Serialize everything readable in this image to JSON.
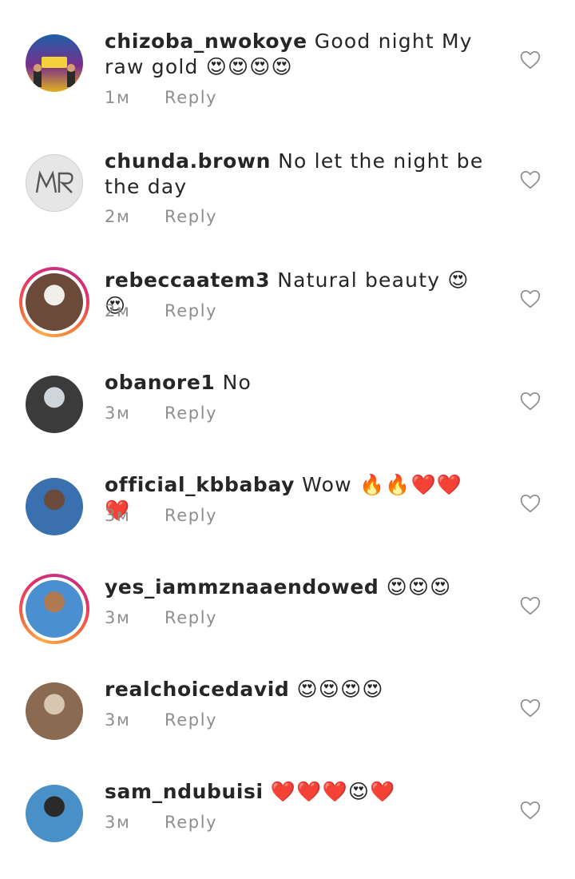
{
  "comments": [
    {
      "username": "chizoba_nwokoye",
      "text": "Good night My raw gold",
      "emoji": "😍😍😍😍",
      "time": "1м",
      "reply_label": "Reply",
      "avatar_icon": "movie-poster-avatar",
      "avatar_colors": [
        "#1f5fa8",
        "#e0b020"
      ],
      "story_ring": false
    },
    {
      "username": "chunda.brown",
      "text": "No let the night be the day",
      "emoji": "",
      "time": "2м",
      "reply_label": "Reply",
      "avatar_icon": "monogram-logo-avatar",
      "avatar_colors": [
        "#e6e6e6",
        "#555555"
      ],
      "story_ring": false
    },
    {
      "username": "rebeccaatem3",
      "text": "Natural beauty",
      "emoji": "😍😍",
      "time": "2м",
      "reply_label": "Reply",
      "avatar_icon": "person-photo-avatar",
      "avatar_colors": [
        "#6b4a3a",
        "#f1efe9"
      ],
      "story_ring": true
    },
    {
      "username": "obanore1",
      "text": "No",
      "emoji": "",
      "time": "3м",
      "reply_label": "Reply",
      "avatar_icon": "person-photo-avatar",
      "avatar_colors": [
        "#3b3b3b",
        "#cfd5da"
      ],
      "story_ring": false
    },
    {
      "username": "official_kbbabay",
      "text": "Wow",
      "emoji": "🔥🔥❤️❤️❤️",
      "time": "3м",
      "reply_label": "Reply",
      "avatar_icon": "person-photo-avatar",
      "avatar_colors": [
        "#3a6fb0",
        "#6a4a3a"
      ],
      "story_ring": false
    },
    {
      "username": "yes_iammznaaendowed",
      "text": "",
      "emoji": "😍😍😍",
      "time": "3м",
      "reply_label": "Reply",
      "avatar_icon": "person-photo-avatar",
      "avatar_colors": [
        "#4a8fd0",
        "#b07a50"
      ],
      "story_ring": true
    },
    {
      "username": "realchoicedavid",
      "text": "",
      "emoji": "😍😍😍😍",
      "time": "3м",
      "reply_label": "Reply",
      "avatar_icon": "person-photo-avatar",
      "avatar_colors": [
        "#8a6a50",
        "#d8c6b0"
      ],
      "story_ring": false
    },
    {
      "username": "sam_ndubuisi",
      "text": "",
      "emoji": "❤️❤️❤️😍❤️",
      "time": "3м",
      "reply_label": "Reply",
      "avatar_icon": "person-photo-avatar",
      "avatar_colors": [
        "#4a90c8",
        "#2a2a2a"
      ],
      "story_ring": false
    }
  ]
}
